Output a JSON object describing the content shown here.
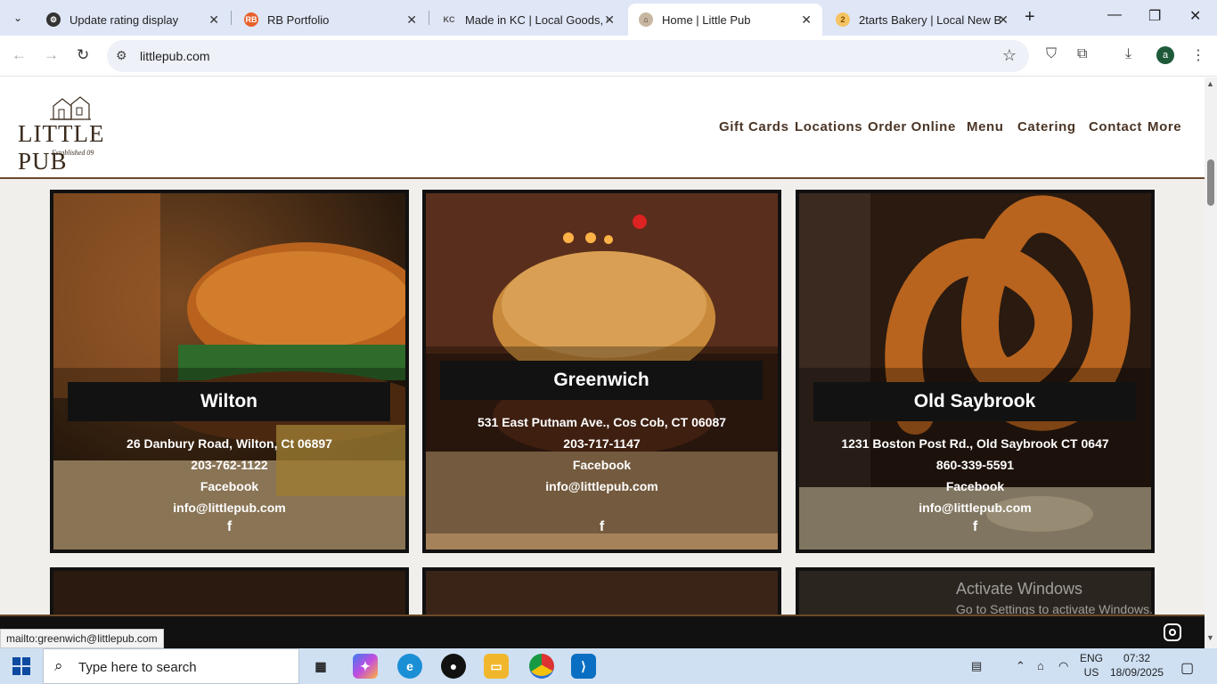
{
  "browser": {
    "tabs": [
      {
        "title": "Update rating display",
        "favicon": "gear-icon",
        "active": false
      },
      {
        "title": "RB Portfolio",
        "favicon": "rb-icon",
        "active": false
      },
      {
        "title": "Made in KC | Local Goods, G",
        "favicon": "kc-icon",
        "active": false
      },
      {
        "title": "Home | Little Pub",
        "favicon": "littlepub-icon",
        "active": true
      },
      {
        "title": "2tarts Bakery | Local New Br",
        "favicon": "bakery-icon",
        "active": false
      }
    ],
    "url": "littlepub.com"
  },
  "site": {
    "logo_text": "LITTLE PUB",
    "logo_est": "Established 09",
    "nav": [
      "Gift Cards",
      "Locations",
      "Order Online",
      "Menu",
      "Catering",
      "Contact",
      "More"
    ],
    "locations": [
      {
        "name": "Wilton",
        "address": "26 Danbury Road, Wilton, Ct 06897",
        "phone": "203-762-1122",
        "facebook": "Facebook",
        "email": "info@littlepub.com"
      },
      {
        "name": "Greenwich",
        "address": "531 East Putnam Ave., Cos Cob, CT 06087",
        "phone": "203-717-1147",
        "facebook": "Facebook",
        "email": "info@littlepub.com"
      },
      {
        "name": "Old Saybrook",
        "address": "1231 Boston Post Rd., Old Saybrook CT 0647",
        "phone": "860-339-5591",
        "facebook": "Facebook",
        "email": "info@littlepub.com"
      }
    ],
    "status_link": "mailto:greenwich@littlepub.com",
    "watermark": {
      "title": "Activate Windows",
      "subtitle": "Go to Settings to activate Windows."
    }
  },
  "taskbar": {
    "search_placeholder": "Type here to search",
    "lang_line1": "ENG",
    "lang_line2": "US",
    "time": "07:32",
    "date": "18/09/2025"
  },
  "colors": {
    "accent_brown": "#6b4a2b",
    "tab_bg": "#dfe6f6",
    "taskbar": "#cfe0f3"
  }
}
